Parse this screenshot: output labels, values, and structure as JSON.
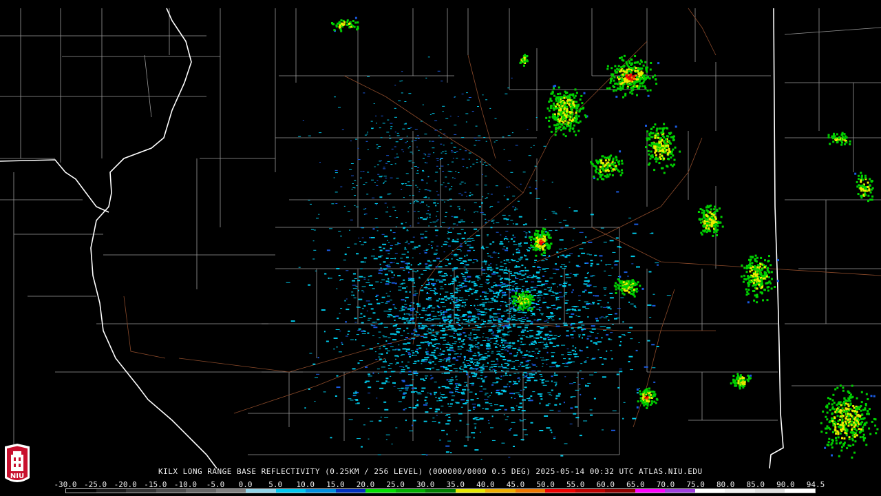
{
  "product": {
    "caption": "KILX LONG RANGE BASE REFLECTIVITY (0.25KM / 256 LEVEL) (000000/0000 0.5 DEG) 2025-05-14 00:32 UTC  ATLAS.NIU.EDU"
  },
  "logo": {
    "text": "NIU",
    "colors": {
      "red": "#c8102e",
      "white": "#ffffff"
    }
  },
  "colorscale": {
    "labels": [
      "-30.0",
      "-25.0",
      "-20.0",
      "-15.0",
      "-10.0",
      "-5.0",
      "0.0",
      "5.0",
      "10.0",
      "15.0",
      "20.0",
      "25.0",
      "30.0",
      "35.0",
      "40.0",
      "45.0",
      "50.0",
      "55.0",
      "60.0",
      "65.0",
      "70.0",
      "75.0",
      "80.0",
      "85.0",
      "90.0",
      "94.5"
    ],
    "colors": [
      "#000000",
      "#1a1a1a",
      "#333333",
      "#4d4d4d",
      "#666666",
      "#808080",
      "#8fd3e8",
      "#00c8f0",
      "#0090e0",
      "#0030c0",
      "#00e000",
      "#00b000",
      "#008000",
      "#e8e800",
      "#f0b000",
      "#f07800",
      "#f00000",
      "#c00000",
      "#900000",
      "#ff00ff",
      "#a040e0",
      "#ffffff",
      "#f0f0f0",
      "#e0e0e0",
      "#ffffff"
    ]
  },
  "map_colors": {
    "state_border": "#ffffff",
    "county_border": "#9a9a9a",
    "road": "#8b4a2a",
    "echo_light": "#00c8e8",
    "echo_blue": "#1a5ae0",
    "echo_green": "#00d000",
    "echo_yellow": "#ecec00",
    "echo_orange": "#f09000",
    "echo_red": "#f00000"
  }
}
